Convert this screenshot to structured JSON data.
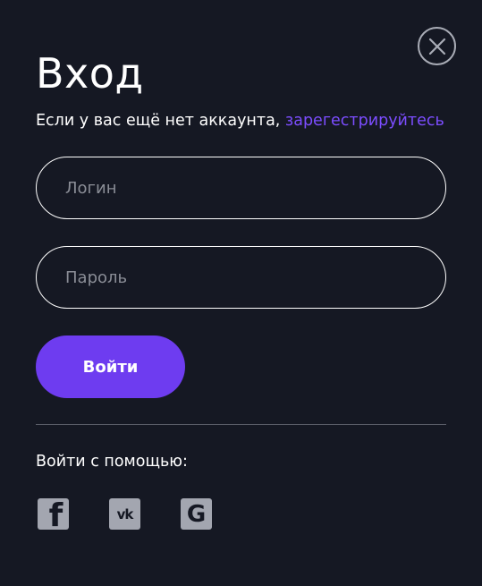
{
  "modal": {
    "title": "Вход",
    "subtitle_text": "Если у вас ещё нет аккаунта, ",
    "register_link": "зарегестрируйтесь",
    "close_icon": "close-icon"
  },
  "form": {
    "login_placeholder": "Логин",
    "password_placeholder": "Пароль",
    "submit_label": "Войти"
  },
  "social": {
    "label": "Войти с помощью:",
    "items": [
      {
        "name": "facebook-icon",
        "glyph": "f"
      },
      {
        "name": "vk-icon",
        "glyph": "vk"
      },
      {
        "name": "google-icon",
        "glyph": "G"
      }
    ]
  },
  "colors": {
    "background": "#151823",
    "accent": "#6e3cf0",
    "link": "#7c4dff",
    "icon": "#a3a6b0"
  }
}
